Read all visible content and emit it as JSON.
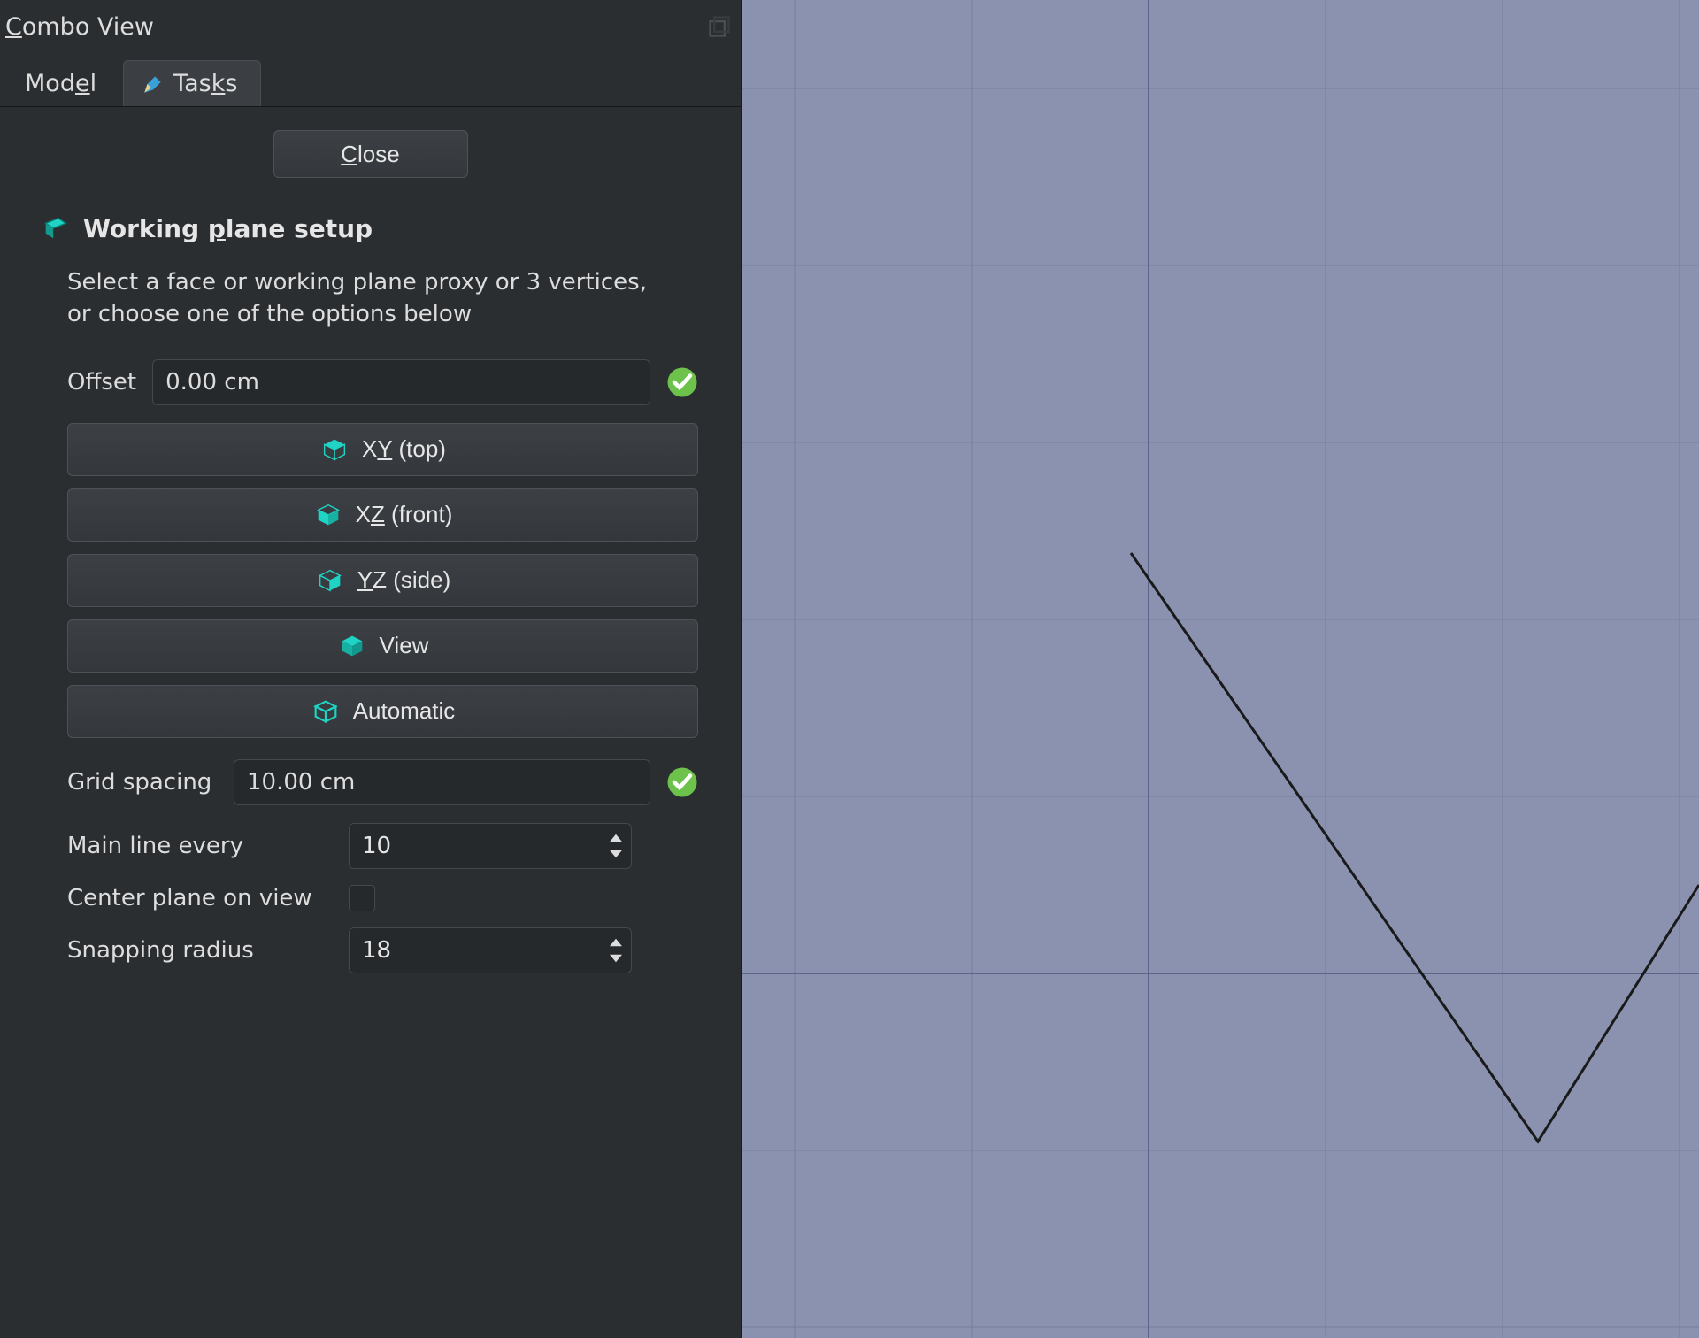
{
  "panel": {
    "title_pre": "C",
    "title_rest": "ombo View",
    "tabs": {
      "model_pre": "Mod",
      "model_u": "e",
      "model_post": "l",
      "tasks_pre": "Tas",
      "tasks_u": "k",
      "tasks_post": "s"
    },
    "close_pre": "C",
    "close_rest": "lose",
    "section_pre": "Working ",
    "section_u": "p",
    "section_post": "lane setup",
    "description": "Select a face or working plane proxy or 3 vertices, or choose one of the options below",
    "offset_label": "Offset",
    "offset_value": "0.00 cm",
    "planes": {
      "xy_pre": "X",
      "xy_u": "Y",
      "xy_post": " (top)",
      "xz_pre": "X",
      "xz_u": "Z",
      "xz_post": " (front)",
      "yz_pre": "",
      "yz_u": "Y",
      "yz_post": "Z (side)",
      "view": "View",
      "auto": "Automatic"
    },
    "grid_spacing_label": "Grid spacing",
    "grid_spacing_value": "10.00 cm",
    "main_line_label": "Main line every",
    "main_line_value": "10",
    "center_label": "Center plane on view",
    "snap_label": "Snapping radius",
    "snap_value": "18"
  },
  "colors": {
    "accent": "#1fd4c4",
    "ok": "#6cc24a"
  }
}
